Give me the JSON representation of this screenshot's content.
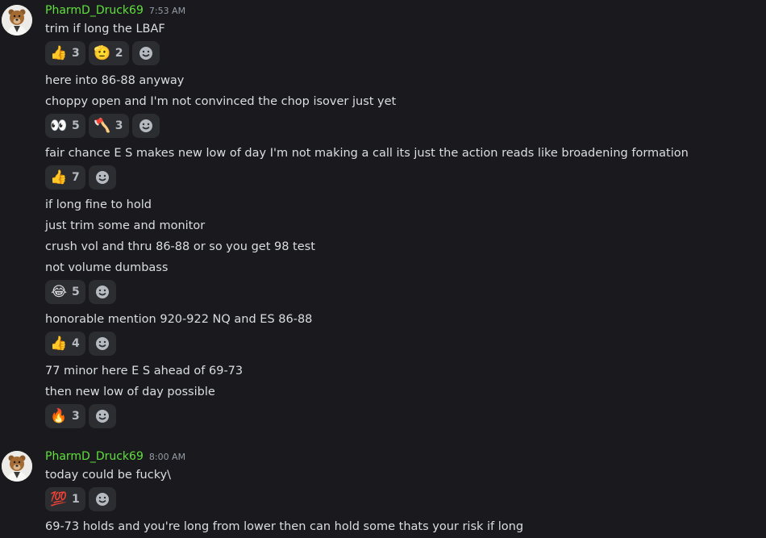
{
  "groups": [
    {
      "author": "PharmD_Druck69",
      "timestamp": "7:53 AM",
      "lines": [
        "trim if long the LBAF",
        "here into 86-88 anyway",
        "choppy open and I'm not convinced the chop isover just yet",
        "fair chance E S makes new low of day I'm not making a call its just the action reads like broadening formation",
        "if long fine to hold",
        "just trim some and monitor",
        "crush vol and thru 86-88 or so you get 98 test",
        "not volume dumbass",
        "honorable mention 920-922 NQ and ES 86-88",
        "77 minor here E S ahead of 69-73",
        "then new low of day possible"
      ],
      "reaction_rows": [
        [
          {
            "emoji": "👍",
            "name": "thumbs-up-emoji",
            "count": "3"
          },
          {
            "emoji": "🫡",
            "name": "salute-emoji",
            "count": "2"
          }
        ],
        [
          {
            "emoji": "👀",
            "name": "eyes-emoji",
            "count": "5"
          },
          {
            "emoji": "🪓",
            "name": "axe-emoji",
            "count": "3"
          }
        ],
        [
          {
            "emoji": "👍",
            "name": "thumbs-up-emoji",
            "count": "7"
          }
        ],
        [
          {
            "emoji": "😂",
            "name": "tears-of-joy-emoji",
            "count": "5"
          }
        ],
        [
          {
            "emoji": "👍",
            "name": "thumbs-up-emoji",
            "count": "4"
          }
        ],
        [
          {
            "emoji": "🔥",
            "name": "fire-emoji",
            "count": "3"
          }
        ]
      ]
    },
    {
      "author": "PharmD_Druck69",
      "timestamp": "8:00 AM",
      "lines": [
        "today could be fucky\\",
        "69-73 holds and you're long from lower then can hold some thats your risk if long"
      ],
      "reaction_rows": [
        [
          {
            "emoji": "💯",
            "name": "hundred-points-emoji",
            "count": "1"
          }
        ]
      ]
    }
  ],
  "colors": {
    "background": "#1a1a1e",
    "author": "#5fe03a",
    "text": "#dbdee1",
    "timestamp": "#949ba4",
    "reaction_bg": "#2b2d31"
  }
}
